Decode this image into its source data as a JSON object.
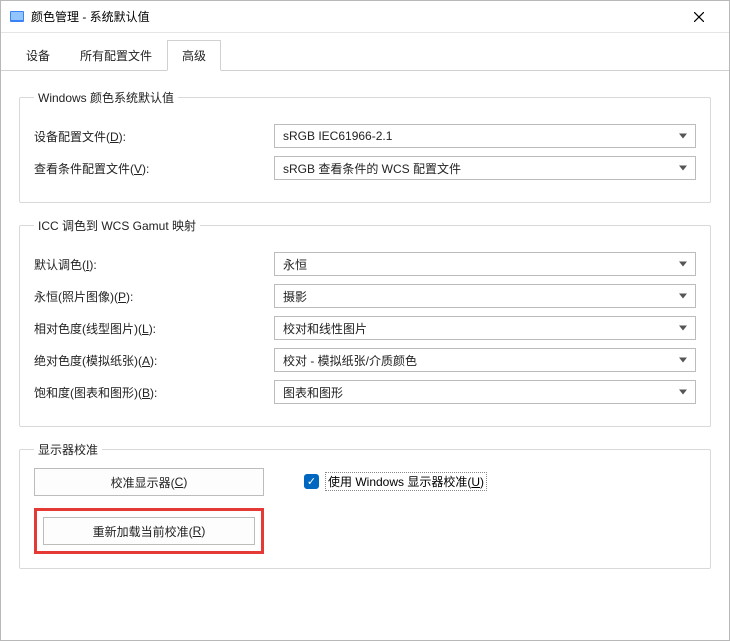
{
  "titlebar": {
    "title": "颜色管理 - 系统默认值"
  },
  "tabs": {
    "items": [
      {
        "label": "设备",
        "active": false
      },
      {
        "label": "所有配置文件",
        "active": false
      },
      {
        "label": "高级",
        "active": true
      }
    ]
  },
  "group_defaults": {
    "legend": "Windows 颜色系统默认值",
    "device_profile": {
      "label_pre": "设备配置文件(",
      "label_ul": "D",
      "label_post": "):",
      "value": "sRGB IEC61966-2.1"
    },
    "viewing_profile": {
      "label_pre": "查看条件配置文件(",
      "label_ul": "V",
      "label_post": "):",
      "value": "sRGB 查看条件的 WCS 配置文件"
    }
  },
  "group_icc": {
    "legend": "ICC 调色到 WCS Gamut 映射",
    "rows": [
      {
        "label_pre": "默认调色(",
        "label_ul": "I",
        "label_post": "):",
        "value": "永恒"
      },
      {
        "label_pre": "永恒(照片图像)(",
        "label_ul": "P",
        "label_post": "):",
        "value": "摄影"
      },
      {
        "label_pre": "相对色度(线型图片)(",
        "label_ul": "L",
        "label_post": "):",
        "value": "校对和线性图片"
      },
      {
        "label_pre": "绝对色度(模拟纸张)(",
        "label_ul": "A",
        "label_post": "):",
        "value": "校对 - 模拟纸张/介质颜色"
      },
      {
        "label_pre": "饱和度(图表和图形)(",
        "label_ul": "B",
        "label_post": "):",
        "value": "图表和图形"
      }
    ]
  },
  "group_calib": {
    "legend": "显示器校准",
    "btn_calibrate": {
      "pre": "校准显示器(",
      "ul": "C",
      "post": ")"
    },
    "btn_reload": {
      "pre": "重新加载当前校准(",
      "ul": "R",
      "post": ")"
    },
    "checkbox": {
      "checked": true,
      "pre": "使用 Windows 显示器校准(",
      "ul": "U",
      "post": ")"
    }
  }
}
